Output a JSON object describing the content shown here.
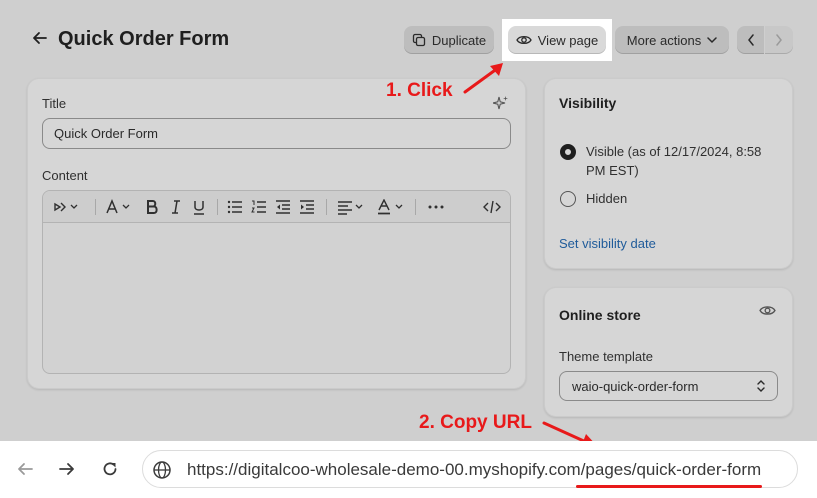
{
  "header": {
    "title": "Quick Order Form",
    "duplicate_label": "Duplicate",
    "view_page_label": "View page",
    "more_actions_label": "More actions"
  },
  "main": {
    "title_label": "Title",
    "title_value": "Quick Order Form",
    "content_label": "Content"
  },
  "visibility": {
    "heading": "Visibility",
    "visible_label": "Visible (as of 12/17/2024, 8:58 PM EST)",
    "hidden_label": "Hidden",
    "set_date_link": "Set visibility date",
    "selected": "visible"
  },
  "online_store": {
    "heading": "Online store",
    "theme_template_label": "Theme template",
    "theme_template_value": "waio-quick-order-form"
  },
  "annotations": {
    "step1": "1. Click",
    "step2": "2. Copy URL",
    "color": "#e8191a"
  },
  "browser": {
    "url_host": "https://digitalcoo-wholesale-demo-00.myshopify.com",
    "url_path": "/pages/quick-order-form"
  },
  "icons": {
    "back": "arrow-left-icon",
    "duplicate": "duplicate-icon",
    "view": "eye-icon",
    "more": "chevron-down-icon",
    "prev": "chevron-left-icon",
    "next": "chevron-right-icon",
    "magic": "sparkle-icon",
    "globe": "globe-icon"
  }
}
